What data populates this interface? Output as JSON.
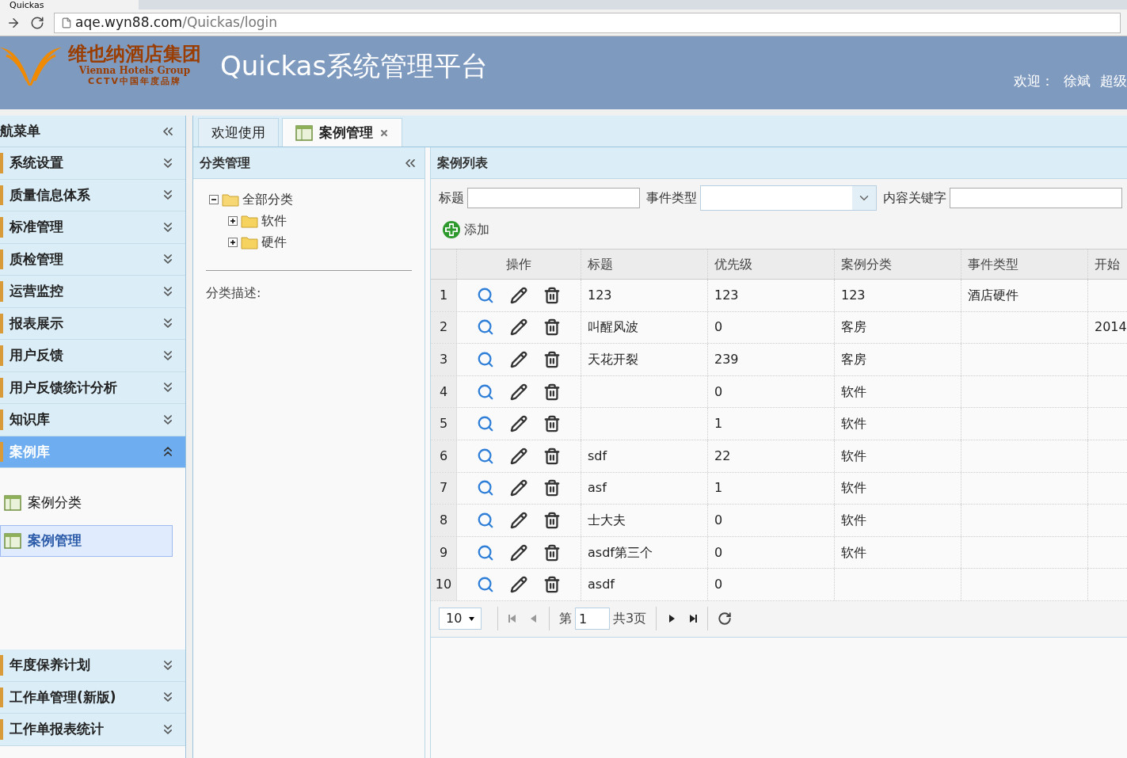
{
  "browser": {
    "tab_title": "Quickas",
    "url_host": "aqe.wyn88.com",
    "url_path": "/Quickas/login"
  },
  "header": {
    "logo_cn": "维也纳酒店集团",
    "logo_en": "Vienna Hotels Group",
    "logo_slogan": "CCTV中国年度品牌",
    "title": "Quickas系统管理平台",
    "welcome": "欢迎：",
    "user": "徐斌",
    "role": "超级"
  },
  "sidebar": {
    "title": "航菜单",
    "items": [
      {
        "label": "系统设置",
        "expanded": false
      },
      {
        "label": "质量信息体系",
        "expanded": false
      },
      {
        "label": "标准管理",
        "expanded": false
      },
      {
        "label": "质检管理",
        "expanded": false
      },
      {
        "label": "运营监控",
        "expanded": false
      },
      {
        "label": "报表展示",
        "expanded": false
      },
      {
        "label": "用户反馈",
        "expanded": false
      },
      {
        "label": "用户反馈统计分析",
        "expanded": false
      },
      {
        "label": "知识库",
        "expanded": false
      },
      {
        "label": "案例库",
        "expanded": true,
        "children": [
          {
            "label": "案例分类",
            "selected": false
          },
          {
            "label": "案例管理",
            "selected": true
          }
        ]
      },
      {
        "label": "年度保养计划",
        "expanded": false
      },
      {
        "label": "工作单管理(新版)",
        "expanded": false
      },
      {
        "label": "工作单报表统计",
        "expanded": false
      }
    ]
  },
  "tabs": [
    {
      "label": "欢迎使用",
      "selected": false,
      "closable": false
    },
    {
      "label": "案例管理",
      "selected": true,
      "closable": true
    }
  ],
  "category_panel": {
    "title": "分类管理",
    "tree": [
      {
        "label": "全部分类",
        "expanded": true,
        "children": [
          {
            "label": "软件",
            "expanded": false
          },
          {
            "label": "硬件",
            "expanded": false
          }
        ]
      }
    ],
    "description_label": "分类描述:"
  },
  "case_list": {
    "title": "案例列表",
    "filters": [
      {
        "label": "标题",
        "kind": "text"
      },
      {
        "label": "事件类型",
        "kind": "select"
      },
      {
        "label": "内容关键字",
        "kind": "text"
      }
    ],
    "add_button": "添加",
    "columns": [
      "操作",
      "标题",
      "优先级",
      "案例分类",
      "事件类型",
      "开始"
    ],
    "rows": [
      {
        "num": "1",
        "title": "123",
        "priority": "123",
        "category": "123",
        "event_type": "酒店硬件",
        "start": ""
      },
      {
        "num": "2",
        "title": "叫醒风波",
        "priority": "0",
        "category": "客房",
        "event_type": "",
        "start": "2014"
      },
      {
        "num": "3",
        "title": "天花开裂",
        "priority": "239",
        "category": "客房",
        "event_type": "",
        "start": ""
      },
      {
        "num": "4",
        "title": "",
        "priority": "0",
        "category": "软件",
        "event_type": "",
        "start": ""
      },
      {
        "num": "5",
        "title": "",
        "priority": "1",
        "category": "软件",
        "event_type": "",
        "start": ""
      },
      {
        "num": "6",
        "title": "sdf",
        "priority": "22",
        "category": "软件",
        "event_type": "",
        "start": ""
      },
      {
        "num": "7",
        "title": "asf",
        "priority": "1",
        "category": "软件",
        "event_type": "",
        "start": ""
      },
      {
        "num": "8",
        "title": "士大夫",
        "priority": "0",
        "category": "软件",
        "event_type": "",
        "start": ""
      },
      {
        "num": "9",
        "title": "asdf第三个",
        "priority": "0",
        "category": "软件",
        "event_type": "",
        "start": ""
      },
      {
        "num": "10",
        "title": "asdf",
        "priority": "0",
        "category": "",
        "event_type": "",
        "start": ""
      }
    ],
    "pager": {
      "page_size": "10",
      "page_prefix": "第",
      "page": "1",
      "total": "共3页"
    }
  }
}
